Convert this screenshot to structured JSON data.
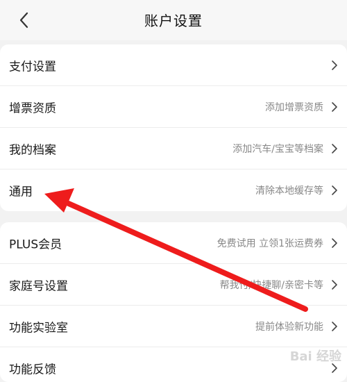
{
  "header": {
    "title": "账户设置",
    "back_icon": "chevron-left-icon"
  },
  "group1": [
    {
      "label": "支付设置",
      "hint": ""
    },
    {
      "label": "增票资质",
      "hint": "添加增票资质"
    },
    {
      "label": "我的档案",
      "hint": "添加汽车/宝宝等档案"
    },
    {
      "label": "通用",
      "hint": "清除本地缓存等"
    }
  ],
  "group2": [
    {
      "label": "PLUS会员",
      "hint": "免费试用 立领1张运费券"
    },
    {
      "label": "家庭号设置",
      "hint": "帮我付/快捷聊/亲密卡等"
    },
    {
      "label": "功能实验室",
      "hint": "提前体验新功能"
    },
    {
      "label": "功能反馈",
      "hint": ""
    }
  ],
  "annotation": {
    "arrow_color": "#ee1c1c",
    "points_to": "通用"
  },
  "watermark": "Bai 经验"
}
